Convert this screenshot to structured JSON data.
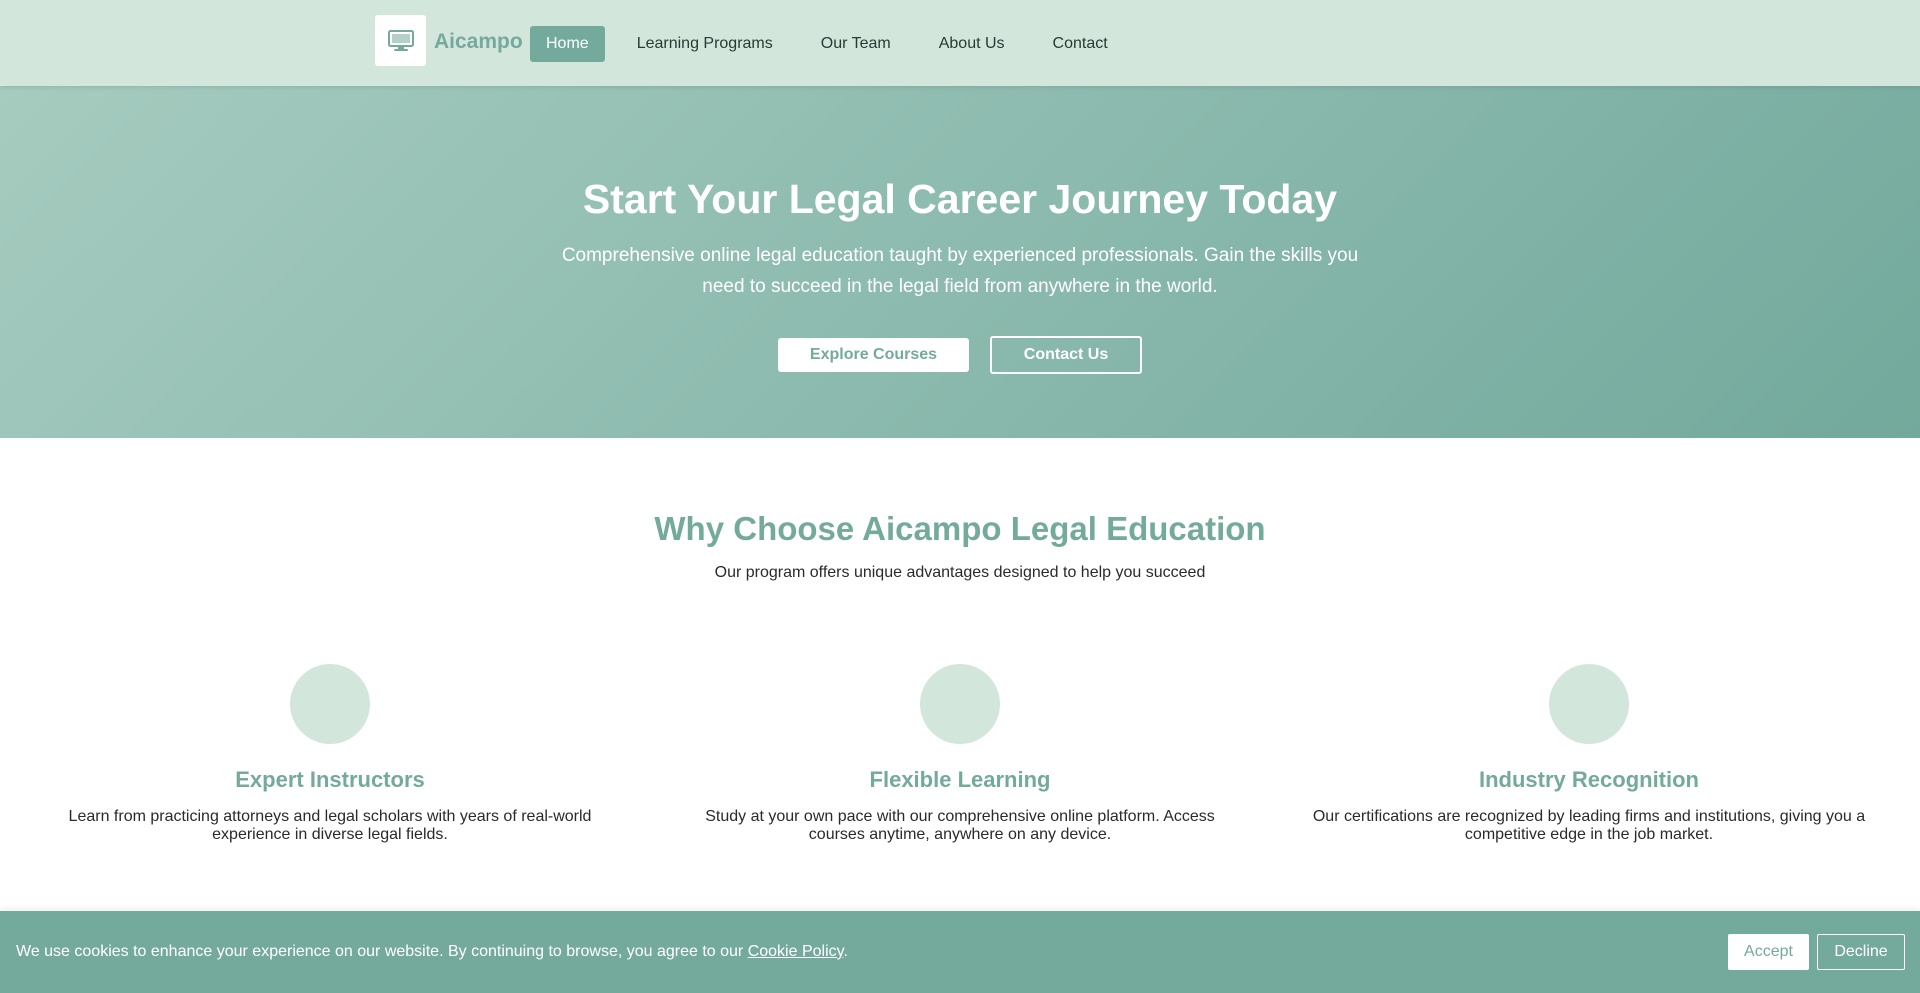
{
  "header": {
    "brand": "Aicampo",
    "logo_icon": "monitor-icon",
    "nav": [
      {
        "label": "Home",
        "active": true
      },
      {
        "label": "Learning Programs",
        "active": false
      },
      {
        "label": "Our Team",
        "active": false
      },
      {
        "label": "About Us",
        "active": false
      },
      {
        "label": "Contact",
        "active": false
      }
    ]
  },
  "hero": {
    "title": "Start Your Legal Career Journey Today",
    "subtitle": "Comprehensive online legal education taught by experienced professionals. Gain the skills you need to succeed in the legal field from anywhere in the world.",
    "primary_button": "Explore Courses",
    "secondary_button": "Contact Us"
  },
  "features": {
    "title": "Why Choose Aicampo Legal Education",
    "subtitle": "Our program offers unique advantages designed to help you succeed",
    "items": [
      {
        "title": "Expert Instructors",
        "text": "Learn from practicing attorneys and legal scholars with years of real-world experience in diverse legal fields."
      },
      {
        "title": "Flexible Learning",
        "text": "Study at your own pace with our comprehensive online platform. Access courses anytime, anywhere on any device."
      },
      {
        "title": "Industry Recognition",
        "text": "Our certifications are recognized by leading firms and institutions, giving you a competitive edge in the job market."
      }
    ]
  },
  "cookie": {
    "text_before": "We use cookies to enhance your experience on our website. By continuing to browse, you agree to our ",
    "link": "Cookie Policy",
    "text_after": ".",
    "accept": "Accept",
    "decline": "Decline"
  },
  "colors": {
    "accent": "#74aa9c",
    "light": "#d2e6dc",
    "text": "#2a2a2a"
  }
}
